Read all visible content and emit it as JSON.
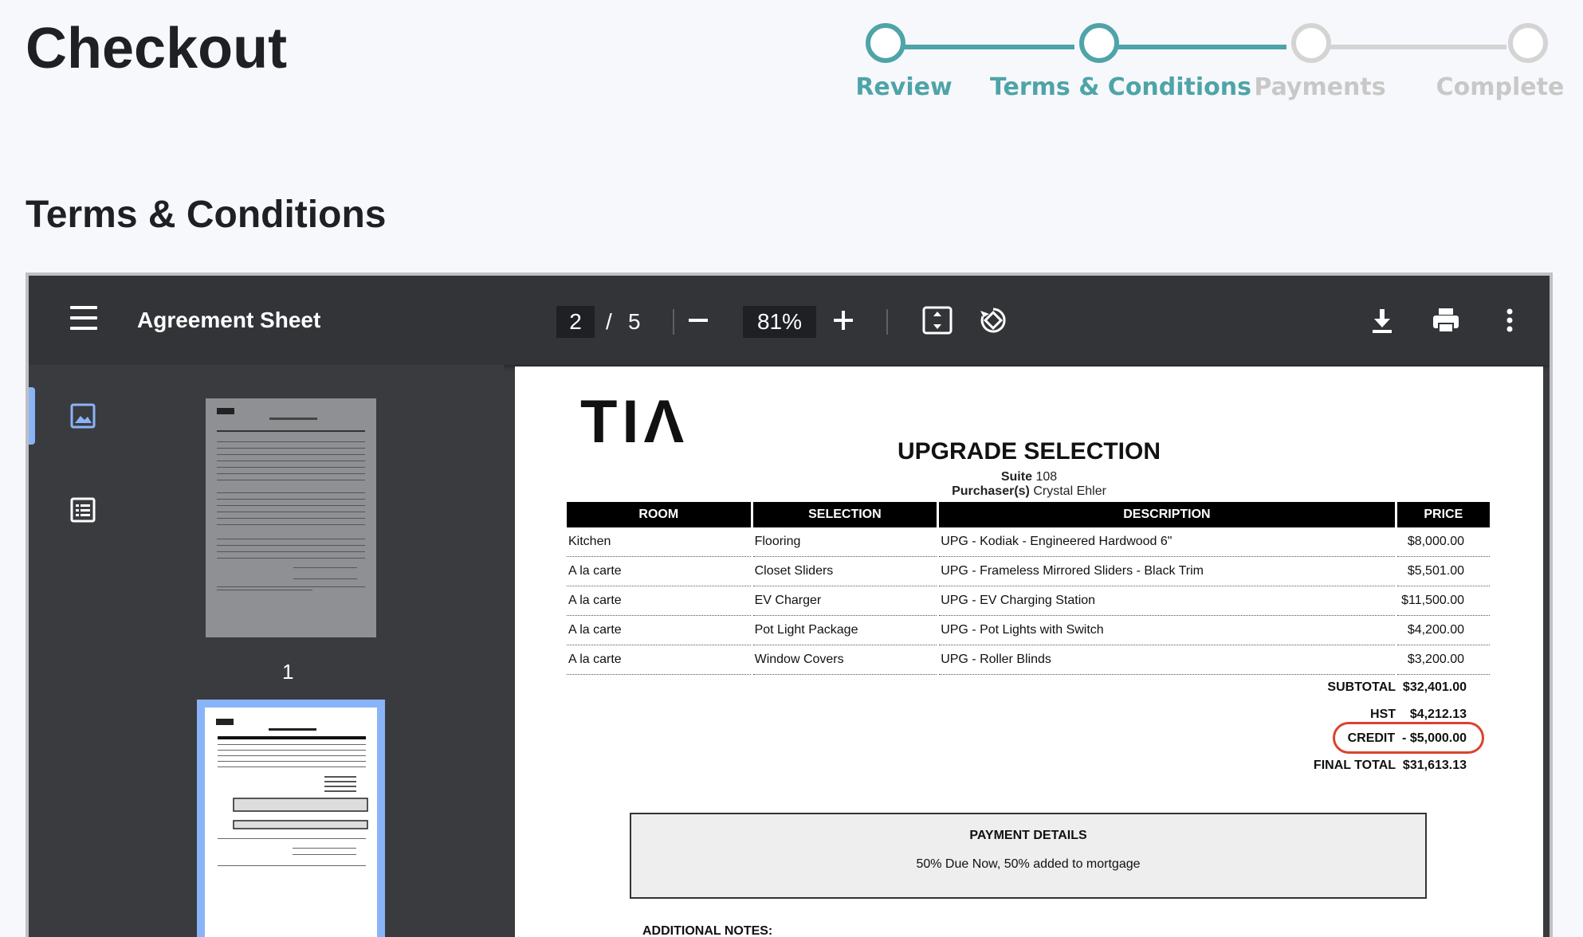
{
  "page": {
    "title": "Checkout",
    "section_title": "Terms & Conditions"
  },
  "stepper": {
    "steps": [
      {
        "label": "Review",
        "state": "complete"
      },
      {
        "label": "Terms & Conditions",
        "state": "current"
      },
      {
        "label": "Payments",
        "state": "upcoming"
      },
      {
        "label": "Complete",
        "state": "upcoming"
      }
    ],
    "colors": {
      "active": "#4ea4a8",
      "inactive": "#d4d4d4"
    }
  },
  "viewer": {
    "title": "Agreement Sheet",
    "current_page": "2",
    "page_separator": "/",
    "total_pages": "5",
    "zoom": "81%",
    "icons": [
      "menu-icon",
      "zoom-out-icon",
      "zoom-in-icon",
      "fit-page-icon",
      "rotate-icon",
      "download-icon",
      "print-icon",
      "more-vert-icon",
      "thumbnails-icon",
      "outline-icon"
    ],
    "thumbnail_label": "1"
  },
  "document": {
    "logo": "TIΛ",
    "heading": "UPGRADE SELECTION",
    "suite_label": "Suite",
    "suite_value": "108",
    "purchaser_label": "Purchaser(s)",
    "purchaser_value": "Crystal Ehler",
    "columns": [
      "ROOM",
      "SELECTION",
      "DESCRIPTION",
      "PRICE"
    ],
    "rows": [
      {
        "room": "Kitchen",
        "selection": "Flooring",
        "description": "UPG - Kodiak - Engineered Hardwood 6\"",
        "price": "$8,000.00"
      },
      {
        "room": "A la carte",
        "selection": "Closet Sliders",
        "description": "UPG - Frameless Mirrored Sliders - Black Trim",
        "price": "$5,501.00"
      },
      {
        "room": "A la carte",
        "selection": "EV Charger",
        "description": "UPG - EV Charging Station",
        "price": "$11,500.00"
      },
      {
        "room": "A la carte",
        "selection": "Pot Light Package",
        "description": "UPG - Pot Lights with Switch",
        "price": "$4,200.00"
      },
      {
        "room": "A la carte",
        "selection": "Window Covers",
        "description": "UPG - Roller Blinds",
        "price": "$3,200.00"
      }
    ],
    "totals": {
      "subtotal_label": "SUBTOTAL",
      "subtotal_value": "$32,401.00",
      "hst_label": "HST",
      "hst_value": "$4,212.13",
      "credit_label": "CREDIT",
      "credit_value": "- $5,000.00",
      "final_label": "FINAL TOTAL",
      "final_value": "$31,613.13"
    },
    "payment": {
      "title": "PAYMENT DETAILS",
      "text": "50% Due Now, 50% added to mortgage"
    },
    "notes_label": "ADDITIONAL NOTES:",
    "highlight_color": "#d9432f"
  }
}
